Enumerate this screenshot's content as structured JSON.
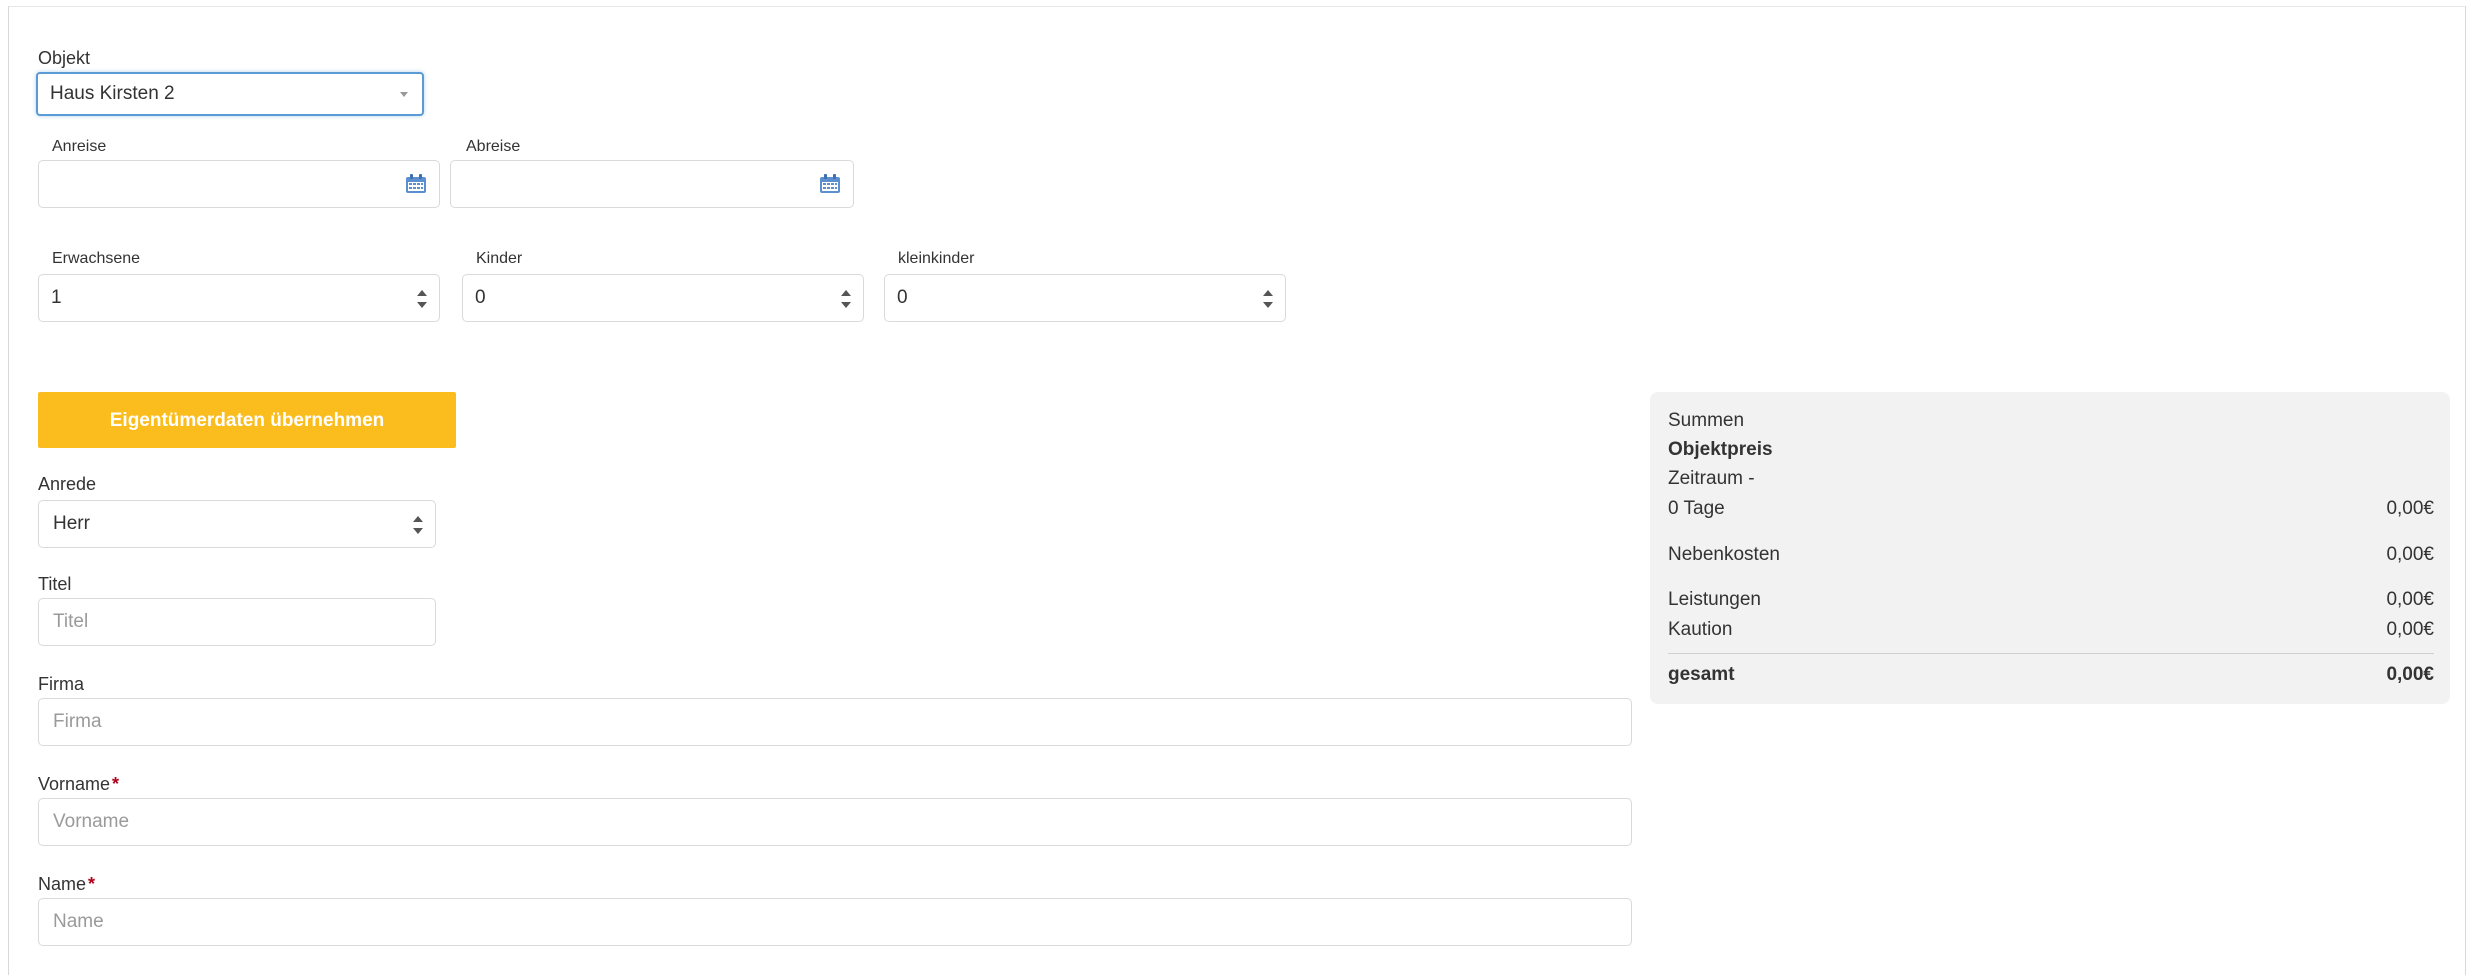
{
  "objekt": {
    "label": "Objekt",
    "value": "Haus Kirsten 2"
  },
  "dates": {
    "anreise": {
      "label": "Anreise",
      "value": ""
    },
    "abreise": {
      "label": "Abreise",
      "value": ""
    },
    "icon": "calendar-icon"
  },
  "guests": {
    "erwachsene": {
      "label": "Erwachsene",
      "value": "1"
    },
    "kinder": {
      "label": "Kinder",
      "value": "0"
    },
    "kleinkinder": {
      "label": "kleinkinder",
      "value": "0"
    }
  },
  "owner_button": {
    "label": "Eigentümerdaten übernehmen",
    "color": "#fbbd1e"
  },
  "form": {
    "anrede": {
      "label": "Anrede",
      "value": "Herr"
    },
    "titel": {
      "label": "Titel",
      "placeholder": "Titel"
    },
    "firma": {
      "label": "Firma",
      "placeholder": "Firma"
    },
    "vorname": {
      "label": "Vorname",
      "placeholder": "Vorname",
      "required_mark": "*"
    },
    "name": {
      "label": "Name",
      "placeholder": "Name",
      "required_mark": "*"
    }
  },
  "summary": {
    "title": "Summen",
    "objektpreis": "Objektpreis",
    "zeitraum": "Zeitraum -",
    "tage": {
      "label": "0 Tage",
      "amount": "0,00€"
    },
    "nebenkosten": {
      "label": "Nebenkosten",
      "amount": "0,00€"
    },
    "leistungen": {
      "label": "Leistungen",
      "amount": "0,00€"
    },
    "kaution": {
      "label": "Kaution",
      "amount": "0,00€"
    },
    "gesamt": {
      "label": "gesamt",
      "amount": "0,00€"
    }
  }
}
